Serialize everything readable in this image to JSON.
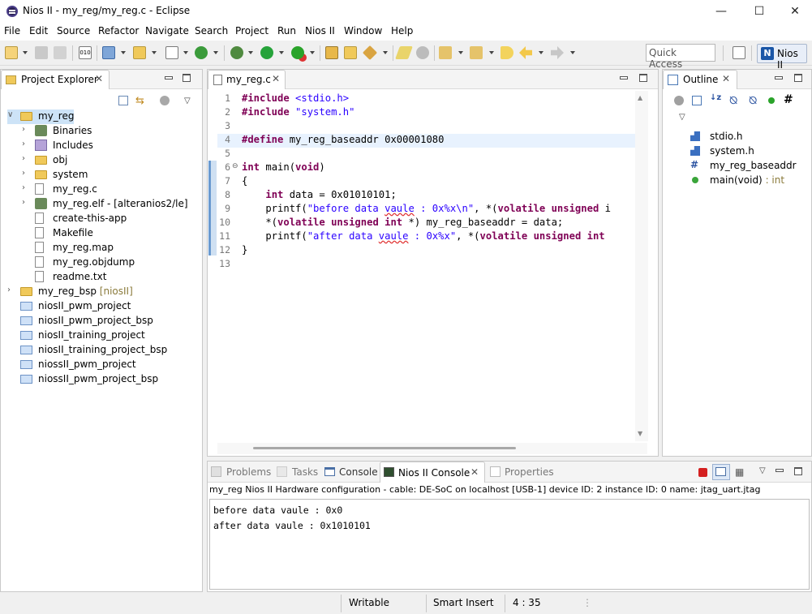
{
  "window": {
    "title": "Nios II - my_reg/my_reg.c - Eclipse"
  },
  "menu": [
    "File",
    "Edit",
    "Source",
    "Refactor",
    "Navigate",
    "Search",
    "Project",
    "Run",
    "Nios II",
    "Window",
    "Help"
  ],
  "toolbar": {
    "quick_access_placeholder": "Quick Access",
    "perspective_label": "Nios II"
  },
  "explorer": {
    "tab_label": "Project Explorer",
    "items": [
      {
        "label": "my_reg",
        "decoration": "",
        "icon": "project-icon",
        "expanded": true
      },
      {
        "label": "Binaries",
        "decoration": "",
        "icon": "binaries-icon"
      },
      {
        "label": "Includes",
        "decoration": "",
        "icon": "includes-icon"
      },
      {
        "label": "obj",
        "decoration": "",
        "icon": "folder-icon"
      },
      {
        "label": "system",
        "decoration": "",
        "icon": "folder-icon"
      },
      {
        "label": "my_reg.c",
        "decoration": "",
        "icon": "c-file-icon"
      },
      {
        "label": "my_reg.elf - [alteranios2/le]",
        "decoration": "",
        "icon": "elf-file-icon"
      },
      {
        "label": "create-this-app",
        "decoration": "",
        "icon": "file-icon"
      },
      {
        "label": "Makefile",
        "decoration": "",
        "icon": "makefile-icon"
      },
      {
        "label": "my_reg.map",
        "decoration": "",
        "icon": "file-icon"
      },
      {
        "label": "my_reg.objdump",
        "decoration": "",
        "icon": "file-icon"
      },
      {
        "label": "readme.txt",
        "decoration": "",
        "icon": "file-icon"
      },
      {
        "label": "my_reg_bsp",
        "decoration": "[niosII]",
        "icon": "project-icon"
      },
      {
        "label": "niosII_pwm_project",
        "decoration": "",
        "icon": "closed-project-icon"
      },
      {
        "label": "niosII_pwm_project_bsp",
        "decoration": "",
        "icon": "closed-project-icon"
      },
      {
        "label": "niosII_training_project",
        "decoration": "",
        "icon": "closed-project-icon"
      },
      {
        "label": "niosII_training_project_bsp",
        "decoration": "",
        "icon": "closed-project-icon"
      },
      {
        "label": "niossII_pwm_project",
        "decoration": "",
        "icon": "closed-project-icon"
      },
      {
        "label": "niossII_pwm_project_bsp",
        "decoration": "",
        "icon": "closed-project-icon"
      }
    ]
  },
  "editor": {
    "tab_label": "my_reg.c",
    "line_numbers": [
      "1",
      "2",
      "3",
      "4",
      "5",
      "6",
      "7",
      "8",
      "9",
      "10",
      "11",
      "12",
      "13"
    ],
    "lines": [
      "#include <stdio.h>",
      "#include \"system.h\"",
      "",
      "#define my_reg_baseaddr 0x00001080",
      "",
      "int main(void)",
      "{",
      "    int data = 0x01010101;",
      "    printf(\"before data vaule : 0x%x\\n\", *(volatile unsigned i",
      "    *(volatile unsigned int *) my_reg_baseaddr = data;",
      "    printf(\"after data vaule : 0x%x\", *(volatile unsigned int",
      "}",
      ""
    ]
  },
  "outline": {
    "tab_label": "Outline",
    "items": [
      {
        "label": "stdio.h",
        "type": ""
      },
      {
        "label": "system.h",
        "type": ""
      },
      {
        "label": "my_reg_baseaddr",
        "type": ""
      },
      {
        "label": "main(void)",
        "type": " : int"
      }
    ]
  },
  "bottom_tabs": [
    "Problems",
    "Tasks",
    "Console",
    "Nios II Console",
    "Properties"
  ],
  "console": {
    "header": "my_reg Nios II Hardware configuration - cable: DE-SoC on localhost [USB-1] device ID: 2 instance ID: 0 name: jtag_uart.jtag",
    "lines": [
      "before data vaule : 0x0",
      "after data vaule : 0x1010101"
    ]
  },
  "status": {
    "mode": "Writable",
    "insert": "Smart Insert",
    "position": "4 : 35"
  }
}
